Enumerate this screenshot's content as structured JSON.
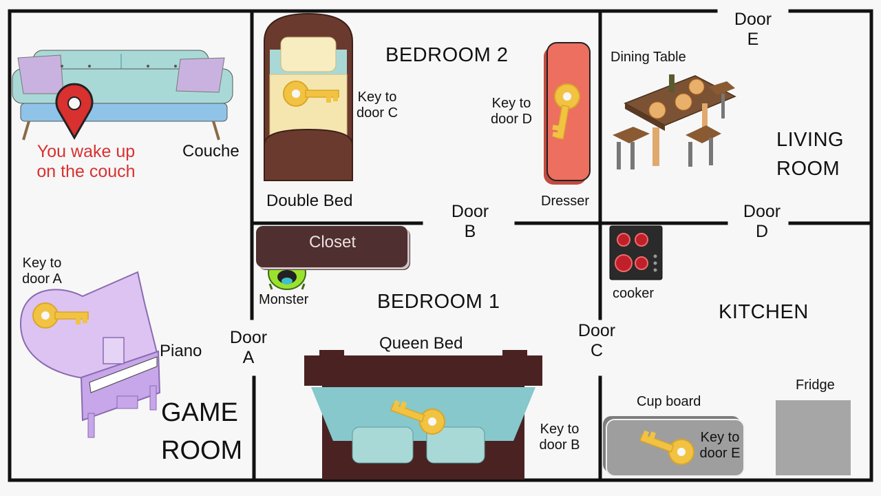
{
  "colors": {
    "wall": "#111111",
    "floor": "#f7f7f7",
    "red_accent": "#d93030",
    "key_gold": "#f2c343",
    "closet": "#4f2f2f",
    "dresser": "#ec6f5f",
    "fridge": "#a6a6a6",
    "cupboard": "#9e9e9e",
    "monster": "#9be22f",
    "piano": "#dcc3f2",
    "couch": "#a9d9d6"
  },
  "rooms": {
    "game_room": [
      "GAME",
      "ROOM"
    ],
    "bedroom_2": "BEDROOM 2",
    "bedroom_1": "BEDROOM 1",
    "living_room": [
      "LIVING",
      "ROOM"
    ],
    "kitchen": "KITCHEN"
  },
  "doors": {
    "a": [
      "Door",
      "A"
    ],
    "b": [
      "Door",
      "B"
    ],
    "c": [
      "Door",
      "C"
    ],
    "d": [
      "Door",
      "D"
    ],
    "e": [
      "Door",
      "E"
    ]
  },
  "objects": {
    "couch": "Couche",
    "start": [
      "You wake up",
      "on the couch"
    ],
    "piano": "Piano",
    "double_bed": "Double Bed",
    "dresser": "Dresser",
    "dining_table": "Dining Table",
    "closet": "Closet",
    "monster": "Monster",
    "queen_bed": "Queen Bed",
    "cooker": "cooker",
    "cupboard": "Cup board",
    "fridge": "Fridge"
  },
  "keys": {
    "a": [
      "Key to",
      "door A"
    ],
    "b": [
      "Key to",
      "door B"
    ],
    "c": [
      "Key to",
      "door C"
    ],
    "d": [
      "Key to",
      "door D"
    ],
    "e": [
      "Key to",
      "door E"
    ]
  },
  "icons": [
    "location-pin-icon",
    "key-icon",
    "couch-icon",
    "piano-icon",
    "bed-icon",
    "dresser-icon",
    "dining-table-icon",
    "monster-icon",
    "cooker-icon",
    "fridge-icon",
    "cupboard-icon"
  ]
}
